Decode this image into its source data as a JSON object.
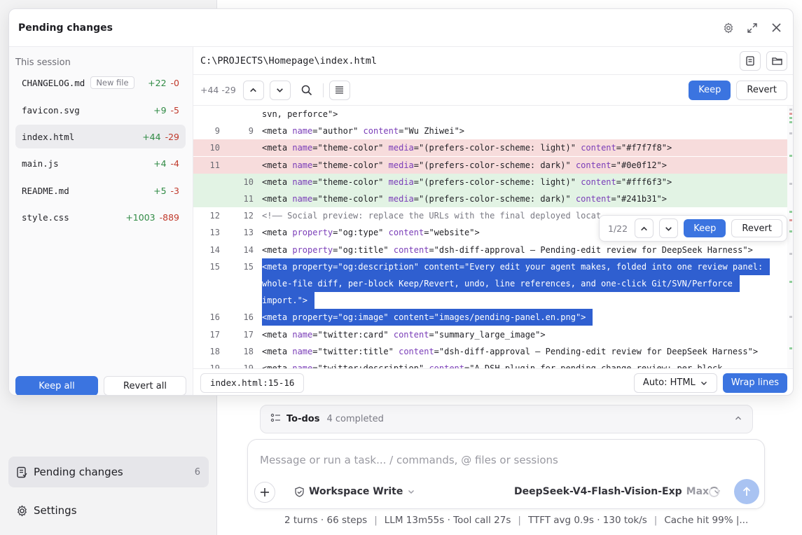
{
  "sidebar": {
    "nav": [
      {
        "label": "Pending changes",
        "count": "6",
        "icon": "pending-changes-icon"
      },
      {
        "label": "Settings",
        "count": "",
        "icon": "gear-icon"
      }
    ]
  },
  "todos": {
    "title": "To-dos",
    "status": "4 completed"
  },
  "composer": {
    "placeholder": "Message or run a task... / commands, @ files or sessions",
    "permission": "Workspace Write",
    "model": "DeepSeek-V4-Flash-Vision-Exp",
    "level": "Max"
  },
  "statusbar": {
    "items": [
      "2 turns · 66 steps",
      "LLM 13m55s · Tool call 27s",
      "TTFT avg 0.9s · 130 tok/s",
      "Cache hit 99%",
      "|..."
    ]
  },
  "panel": {
    "title": "Pending changes",
    "session_label": "This session",
    "files": [
      {
        "name": "CHANGELOG.md",
        "badge": "New file",
        "added": "+22",
        "removed": "-0"
      },
      {
        "name": "favicon.svg",
        "badge": "",
        "added": "+9",
        "removed": "-5"
      },
      {
        "name": "index.html",
        "badge": "",
        "added": "+44",
        "removed": "-29",
        "selected": true
      },
      {
        "name": "main.js",
        "badge": "",
        "added": "+4",
        "removed": "-4"
      },
      {
        "name": "README.md",
        "badge": "",
        "added": "+5",
        "removed": "-3"
      },
      {
        "name": "style.css",
        "badge": "",
        "added": "+1003",
        "removed": "-889"
      }
    ],
    "keep_all": "Keep all",
    "revert_all": "Revert all"
  },
  "diff": {
    "path": "C:\\PROJECTS\\Homepage\\index.html",
    "stats": "+44 -29",
    "keep": "Keep",
    "revert": "Revert",
    "hunk": {
      "counter": "1/22",
      "keep": "Keep",
      "revert": "Revert"
    },
    "line_ref": "index.html:15-16",
    "language": "Auto: HTML",
    "wrap": "Wrap lines",
    "colors": {
      "deleted": "#f7dcdc",
      "added": "#e2f3e4",
      "selection": "#2f5fd0",
      "accent": "#3b74e0"
    }
  },
  "code_lines": [
    {
      "old": "",
      "new": "",
      "type": "ctx",
      "tokens": [
        {
          "c": "tn",
          "t": "svn, perforce\">"
        }
      ]
    },
    {
      "old": "9",
      "new": "9",
      "type": "ctx",
      "tokens": [
        {
          "c": "tn",
          "t": "<meta "
        },
        {
          "c": "ta",
          "t": "name"
        },
        {
          "c": "tv",
          "t": "=\"author\" "
        },
        {
          "c": "ta",
          "t": "content"
        },
        {
          "c": "tv",
          "t": "=\"Wu Zhiwei\">"
        }
      ]
    },
    {
      "old": "10",
      "new": "",
      "type": "del",
      "tokens": [
        {
          "c": "tn",
          "t": "<meta "
        },
        {
          "c": "ta",
          "t": "name"
        },
        {
          "c": "tv",
          "t": "=\"theme-color\" "
        },
        {
          "c": "ta",
          "t": "media"
        },
        {
          "c": "tv",
          "t": "=\"(prefers-color-scheme: light)\" "
        },
        {
          "c": "ta",
          "t": "content"
        },
        {
          "c": "tv",
          "t": "=\"#f7f7f8\">"
        }
      ]
    },
    {
      "old": "11",
      "new": "",
      "type": "del",
      "tokens": [
        {
          "c": "tn",
          "t": "<meta "
        },
        {
          "c": "ta",
          "t": "name"
        },
        {
          "c": "tv",
          "t": "=\"theme-color\" "
        },
        {
          "c": "ta",
          "t": "media"
        },
        {
          "c": "tv",
          "t": "=\"(prefers-color-scheme: dark)\" "
        },
        {
          "c": "ta",
          "t": "content"
        },
        {
          "c": "tv",
          "t": "=\"#0e0f12\">"
        }
      ]
    },
    {
      "old": "",
      "new": "10",
      "type": "add",
      "tokens": [
        {
          "c": "tn",
          "t": "<meta "
        },
        {
          "c": "ta",
          "t": "name"
        },
        {
          "c": "tv",
          "t": "=\"theme-color\" "
        },
        {
          "c": "ta",
          "t": "media"
        },
        {
          "c": "tv",
          "t": "=\"(prefers-color-scheme: light)\" "
        },
        {
          "c": "ta",
          "t": "content"
        },
        {
          "c": "tv",
          "t": "=\"#fff6f3\">"
        }
      ]
    },
    {
      "old": "",
      "new": "11",
      "type": "add",
      "tokens": [
        {
          "c": "tn",
          "t": "<meta "
        },
        {
          "c": "ta",
          "t": "name"
        },
        {
          "c": "tv",
          "t": "=\"theme-color\" "
        },
        {
          "c": "ta",
          "t": "media"
        },
        {
          "c": "tv",
          "t": "=\"(prefers-color-scheme: dark)\" "
        },
        {
          "c": "ta",
          "t": "content"
        },
        {
          "c": "tv",
          "t": "=\"#241b31\">"
        }
      ]
    },
    {
      "old": "12",
      "new": "12",
      "type": "ctx",
      "tokens": [
        {
          "c": "tc",
          "t": "<!—— Social preview: replace the URLs with the final deployed locat"
        }
      ]
    },
    {
      "old": "13",
      "new": "13",
      "type": "ctx",
      "tokens": [
        {
          "c": "tn",
          "t": "<meta "
        },
        {
          "c": "ta",
          "t": "property"
        },
        {
          "c": "tv",
          "t": "=\"og:type\" "
        },
        {
          "c": "ta",
          "t": "content"
        },
        {
          "c": "tv",
          "t": "=\"website\">"
        }
      ]
    },
    {
      "old": "14",
      "new": "14",
      "type": "ctx",
      "tokens": [
        {
          "c": "tn",
          "t": "<meta "
        },
        {
          "c": "ta",
          "t": "property"
        },
        {
          "c": "tv",
          "t": "=\"og:title\" "
        },
        {
          "c": "ta",
          "t": "content"
        },
        {
          "c": "tv",
          "t": "=\"dsh-diff-approval — Pending-edit review for DeepSeek Harness\">"
        }
      ]
    },
    {
      "old": "15",
      "new": "15",
      "type": "hl",
      "tokens": [
        {
          "c": "tn",
          "t": "<meta "
        },
        {
          "c": "ta",
          "t": "property"
        },
        {
          "c": "tv",
          "t": "=\"og:description\" "
        },
        {
          "c": "ta",
          "t": "content"
        },
        {
          "c": "tv",
          "t": "=\"Every edit your agent makes, folded into one review panel:"
        }
      ]
    },
    {
      "old": "",
      "new": "",
      "type": "hl",
      "tokens": [
        {
          "c": "tv",
          "t": "whole-file diff, per-block Keep/Revert, undo, line references, and one-click Git/SVN/Perforce"
        }
      ]
    },
    {
      "old": "",
      "new": "",
      "type": "hl",
      "tokens": [
        {
          "c": "tv",
          "t": "import.\">"
        }
      ]
    },
    {
      "old": "16",
      "new": "16",
      "type": "hl",
      "tokens": [
        {
          "c": "tn",
          "t": "<meta "
        },
        {
          "c": "ta",
          "t": "property"
        },
        {
          "c": "tv",
          "t": "=\"og:image\" "
        },
        {
          "c": "ta",
          "t": "content"
        },
        {
          "c": "tv",
          "t": "=\"images/pending-panel.en.png\">"
        }
      ]
    },
    {
      "old": "17",
      "new": "17",
      "type": "ctx",
      "tokens": [
        {
          "c": "tn",
          "t": "<meta "
        },
        {
          "c": "ta",
          "t": "name"
        },
        {
          "c": "tv",
          "t": "=\"twitter:card\" "
        },
        {
          "c": "ta",
          "t": "content"
        },
        {
          "c": "tv",
          "t": "=\"summary_large_image\">"
        }
      ]
    },
    {
      "old": "18",
      "new": "18",
      "type": "ctx",
      "tokens": [
        {
          "c": "tn",
          "t": "<meta "
        },
        {
          "c": "ta",
          "t": "name"
        },
        {
          "c": "tv",
          "t": "=\"twitter:title\" "
        },
        {
          "c": "ta",
          "t": "content"
        },
        {
          "c": "tv",
          "t": "=\"dsh-diff-approval — Pending-edit review for DeepSeek Harness\">"
        }
      ]
    },
    {
      "old": "19",
      "new": "19",
      "type": "ctx",
      "tokens": [
        {
          "c": "tn",
          "t": "<meta "
        },
        {
          "c": "ta",
          "t": "name"
        },
        {
          "c": "tv",
          "t": "=\"twitter:description\" "
        },
        {
          "c": "ta",
          "t": "content"
        },
        {
          "c": "tv",
          "t": "=\"A DSH plugin for pending-change review: per-block"
        }
      ]
    }
  ]
}
